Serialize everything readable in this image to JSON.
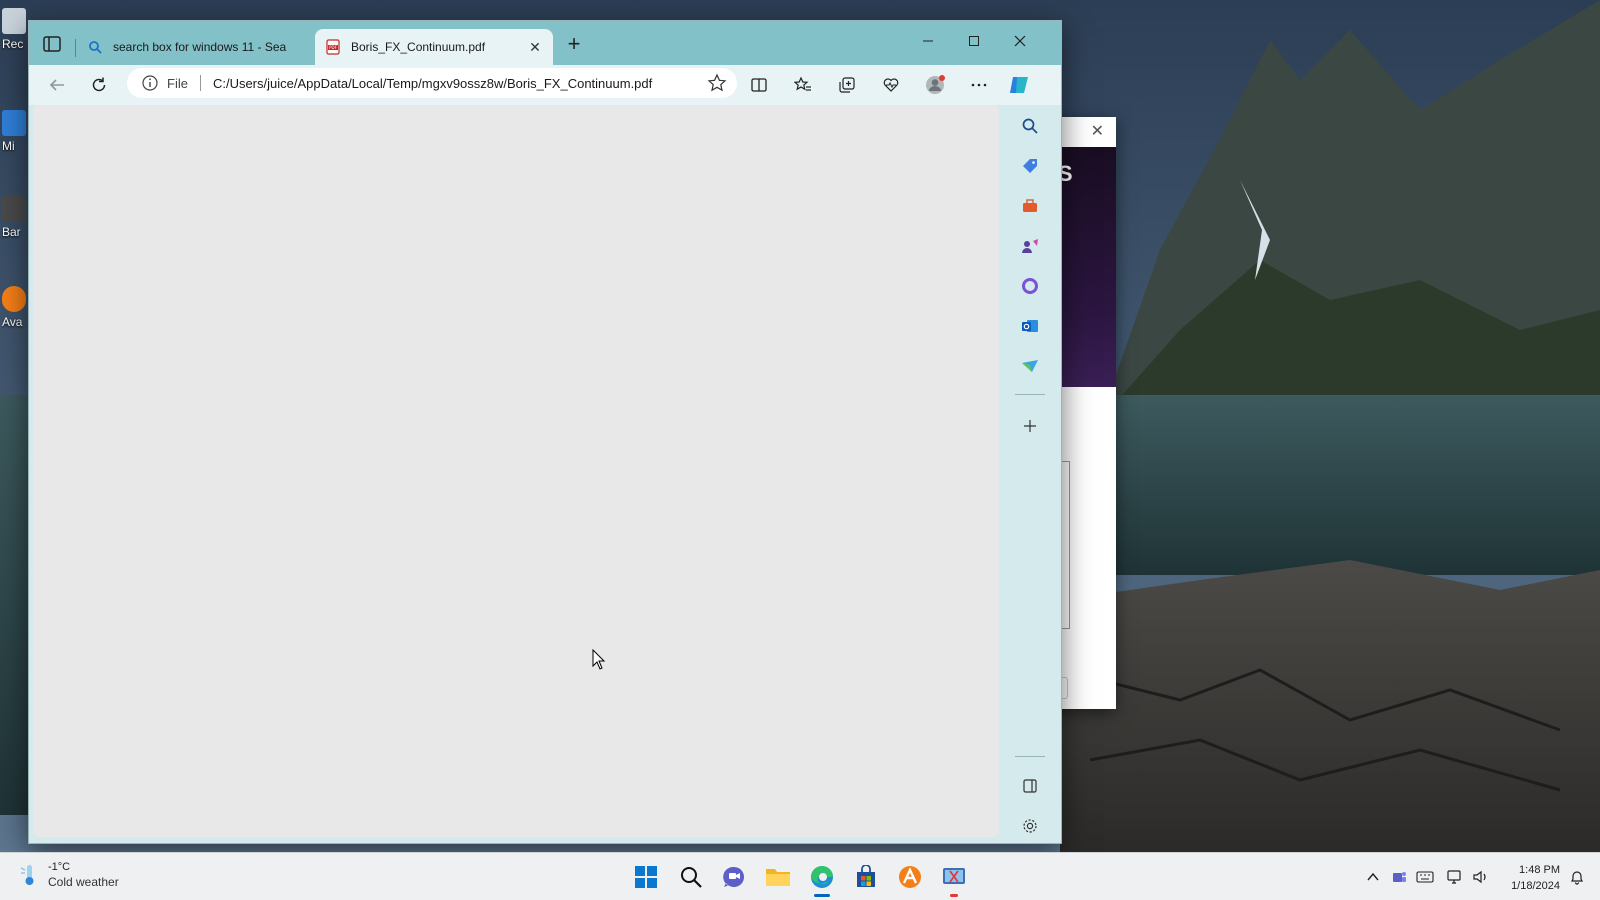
{
  "desktop": {
    "icons": [
      {
        "label": "Rec",
        "color": "#c9d3db"
      },
      {
        "label": "Mi",
        "color": "#2f7fd8"
      },
      {
        "label": "Bar",
        "color": "#4a4a4a"
      },
      {
        "label": "Ava",
        "color": "#f57f17"
      }
    ]
  },
  "dialog": {
    "banner_text": "AS",
    "button_label": "el",
    "close_glyph": "✕"
  },
  "browser": {
    "tabs": [
      {
        "title": "search box for windows 11 - Sea",
        "icon": "search-icon",
        "active": false
      },
      {
        "title": "Boris_FX_Continuum.pdf",
        "icon": "pdf-icon",
        "active": true
      }
    ],
    "new_tab_glyph": "+",
    "address": {
      "scheme_label": "File",
      "url": "C:/Users/juice/AppData/Local/Temp/mgxv9ossz8w/Boris_FX_Continuum.pdf"
    },
    "sidebar_icons": [
      "search-icon",
      "shopping-tag-icon",
      "tools-icon",
      "games-icon",
      "microsoft-365-icon",
      "outlook-icon",
      "drop-icon",
      "add-icon"
    ]
  },
  "taskbar": {
    "weather": {
      "temperature": "-1°C",
      "condition": "Cold weather"
    },
    "apps": [
      "start-icon",
      "search-icon",
      "teams-chat-icon",
      "file-explorer-icon",
      "edge-icon",
      "store-icon",
      "avast-icon",
      "snipping-tool-icon"
    ],
    "clock": {
      "time": "1:48 PM",
      "date": "1/18/2024"
    }
  },
  "colors": {
    "title_bar": "#82c1c8",
    "toolbar": "#e8f3f5",
    "content": "#e8e8e8",
    "taskbar": "#eef0f2",
    "accent": "#0067c0"
  }
}
